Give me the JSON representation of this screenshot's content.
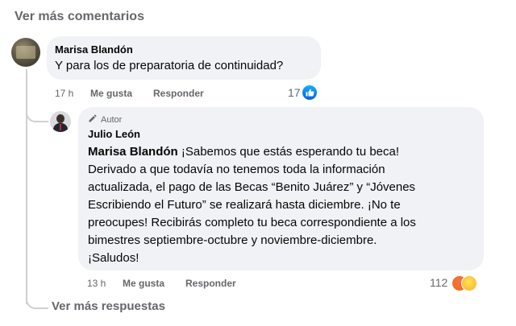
{
  "top": {
    "view_more_comments": "Ver más comentarios"
  },
  "comment1": {
    "author": "Marisa Blandón",
    "text": "Y para los de preparatoria de continuidad?",
    "time": "17 h",
    "like": "Me gusta",
    "reply": "Responder",
    "reaction_count": "17",
    "reaction_icon": "like-icon"
  },
  "reply1": {
    "author_badge": "Autor",
    "author_badge_icon": "pencil-icon",
    "author": "Julio León",
    "mention": "Marisa Blandón",
    "text_lines": [
      " ¡Sabemos que estás esperando tu beca!",
      "Derivado a que todavía no tenemos toda la información",
      "actualizada, el pago de las Becas “Benito Juárez” y “Jóvenes",
      "Escribiendo el Futuro” se realizará hasta diciembre. ¡No te",
      "preocupes! Recibirás completo tu beca correspondiente a los",
      "bimestres septiembre-octubre y noviembre-diciembre.",
      "¡Saludos!"
    ],
    "time": "13 h",
    "like": "Me gusta",
    "reply": "Responder",
    "reaction_count": "112",
    "reaction_icons": [
      "angry-icon",
      "sad-icon"
    ]
  },
  "bottom": {
    "view_more_replies": "Ver más respuestas"
  },
  "colors": {
    "muted": "#65676b",
    "bubble": "#f0f2f5",
    "like_blue": "#0866ff",
    "thread": "#ced0d4"
  }
}
